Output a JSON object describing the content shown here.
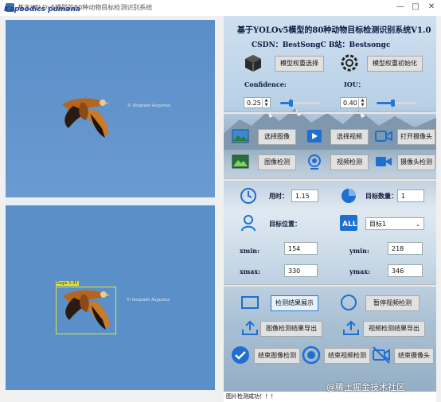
{
  "window": {
    "title": "基于YOLOv5模型的80种动物目标检测识别系统",
    "overlay_text": "Kapoodics pumana",
    "min_glyph": "—",
    "max_glyph": "□",
    "close_glyph": "✕"
  },
  "left": {
    "original": {
      "credit": "© Unsplash Augustus"
    },
    "detected": {
      "credit": "© Unsplash Augustus",
      "label": "Eagle 0.93"
    }
  },
  "panel": {
    "title": "基于YOLOv5模型的80种动物目标检测识别系统V1.0",
    "subtitle": "CSDN：BestSongC   B站：Bestsongc",
    "buttons": {
      "select_weights": "模型权重选择",
      "init_weights": "模型权重初始化",
      "select_image": "选择图像",
      "select_video": "选择视频",
      "open_camera": "打开摄像头",
      "image_detect": "图像检测",
      "video_detect": "视频检测",
      "camera_detect": "摄像头检测",
      "show_result": "检测结果展示",
      "pause_video": "暂停视频检测",
      "export_image": "图像检测结果导出",
      "export_video": "视频检测结果导出",
      "end_image": "结束图像检测",
      "end_video": "结束视频检测",
      "end_camera": "结束摄像头"
    },
    "confidence": {
      "label": "Confidence:",
      "value": "0.25",
      "slider_fraction": 0.25
    },
    "iou": {
      "label": "IOU：",
      "value": "0.40",
      "slider_fraction": 0.4
    },
    "stats": {
      "time_label": "用时：",
      "time_value": "1.15",
      "count_label": "目标数量：",
      "count_value": "1",
      "pos_label": "目标位置：",
      "target_select": "目标1",
      "xmin_label": "xmin:",
      "xmin_value": "154",
      "ymin_label": "ymin:",
      "ymin_value": "218",
      "xmax_label": "xmax:",
      "xmax_value": "330",
      "ymax_label": "ymax:",
      "ymax_value": "346"
    }
  },
  "status_bar": {
    "text": "图片检测成功！！！"
  },
  "bottom_watermark": "@稀土掘金技术社区",
  "colors": {
    "accent": "#1e78d7",
    "image_bg": "#5b8fc8",
    "det_box": "#e3e636"
  }
}
